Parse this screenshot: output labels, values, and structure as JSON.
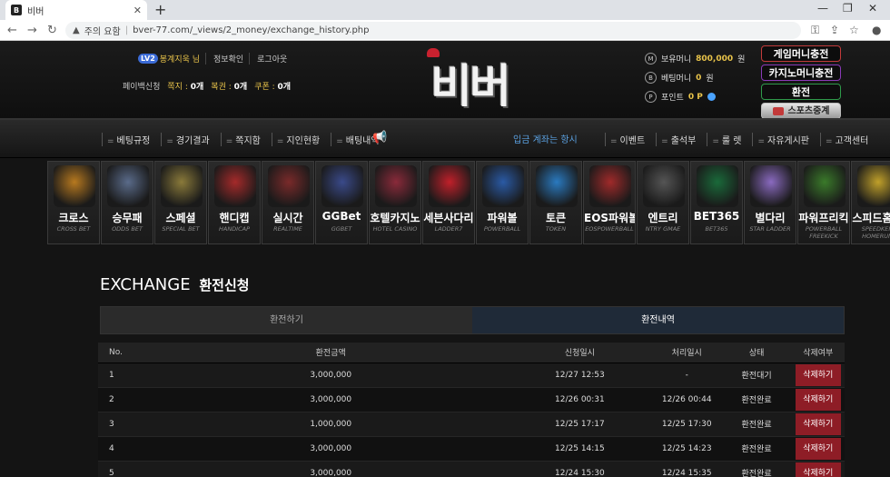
{
  "browser": {
    "tab_title": "비버",
    "favicon": "B",
    "url_warning": "주의 요함",
    "url": "bver-77.com/_views/2_money/exchange_history.php"
  },
  "user": {
    "level": "LV2",
    "name": "봉계지욱 님",
    "profile_btn": "정보확인",
    "logout_btn": "로그아웃",
    "payback": "페이백신청",
    "notes_label": "쪽지 :",
    "notes_value": "0개",
    "lotto_label": "복권 :",
    "lotto_value": "0개",
    "coupon_label": "쿠폰 :",
    "coupon_value": "0개"
  },
  "logo": "비버",
  "money": {
    "hold_label": "보유머니",
    "hold_value": "800,000",
    "bet_label": "베팅머니",
    "bet_value": "0",
    "point_label": "포인트",
    "point_value": "0 P",
    "unit": "원",
    "icons": [
      "M",
      "B",
      "P"
    ]
  },
  "right_buttons": {
    "game_charge": "게임머니충전",
    "casino_charge": "카지노머니충전",
    "exchange": "환전",
    "sports_live": "스포츠중계"
  },
  "nav_left": [
    "베팅규정",
    "경기결과",
    "쪽지함",
    "지인현황",
    "배팅내역"
  ],
  "ticker": "입금 계좌는 항시",
  "nav_right": [
    "이벤트",
    "출석부",
    "룰 렛",
    "자유게시판",
    "고객센터"
  ],
  "tiles": [
    {
      "name": "크로스",
      "sub": "CROSS BET",
      "color": "#b7791f"
    },
    {
      "name": "승무패",
      "sub": "ODDS BET",
      "color": "#5a6b8a"
    },
    {
      "name": "스페셜",
      "sub": "SPECIAL BET",
      "color": "#8a7a3a"
    },
    {
      "name": "핸디캡",
      "sub": "HANDICAP",
      "color": "#a52a2a"
    },
    {
      "name": "실시간",
      "sub": "REALTIME",
      "color": "#7a2a2a"
    },
    {
      "name": "GGBet",
      "sub": "GGBET",
      "color": "#3a4a8a"
    },
    {
      "name": "호텔카지노",
      "sub": "HOTEL CASINO",
      "color": "#8a2a3a"
    },
    {
      "name": "세븐사다리",
      "sub": "LADDER7",
      "color": "#c0202a"
    },
    {
      "name": "파워볼",
      "sub": "POWERBALL",
      "color": "#2a5aa5"
    },
    {
      "name": "토큰",
      "sub": "TOKEN",
      "color": "#2a7ac0"
    },
    {
      "name": "EOS파워볼",
      "sub": "EOSPOWERBALL",
      "color": "#a02a2a"
    },
    {
      "name": "엔트리",
      "sub": "NTRY GMAE",
      "color": "#555555"
    },
    {
      "name": "BET365",
      "sub": "BET365",
      "color": "#1a6a3a"
    },
    {
      "name": "별다리",
      "sub": "STAR LADDER",
      "color": "#8a6ac0"
    },
    {
      "name": "파워프리킥",
      "sub": "POWERBALL FREEKICK",
      "color": "#3a7a2a"
    },
    {
      "name": "스피드홈런",
      "sub": "SPEEDKEN HOMERUN",
      "color": "#c0a02a"
    }
  ],
  "page": {
    "title_en": "EXCHANGE",
    "title_ko": "환전신청"
  },
  "subtabs": {
    "request": "환전하기",
    "history": "환전내역"
  },
  "table": {
    "headers": [
      "No.",
      "환전금액",
      "신청일시",
      "처리일시",
      "상태",
      "삭제여부"
    ],
    "rows": [
      {
        "no": "1",
        "amount": "3,000,000",
        "requested": "12/27 12:53",
        "processed": "-",
        "status": "환전대기",
        "action": "삭제하기"
      },
      {
        "no": "2",
        "amount": "3,000,000",
        "requested": "12/26 00:31",
        "processed": "12/26 00:44",
        "status": "환전완료",
        "action": "삭제하기"
      },
      {
        "no": "3",
        "amount": "1,000,000",
        "requested": "12/25 17:17",
        "processed": "12/25 17:30",
        "status": "환전완료",
        "action": "삭제하기"
      },
      {
        "no": "4",
        "amount": "3,000,000",
        "requested": "12/25 14:15",
        "processed": "12/25 14:23",
        "status": "환전완료",
        "action": "삭제하기"
      },
      {
        "no": "5",
        "amount": "3,000,000",
        "requested": "12/24 15:30",
        "processed": "12/24 15:35",
        "status": "환전완료",
        "action": "삭제하기"
      }
    ]
  }
}
